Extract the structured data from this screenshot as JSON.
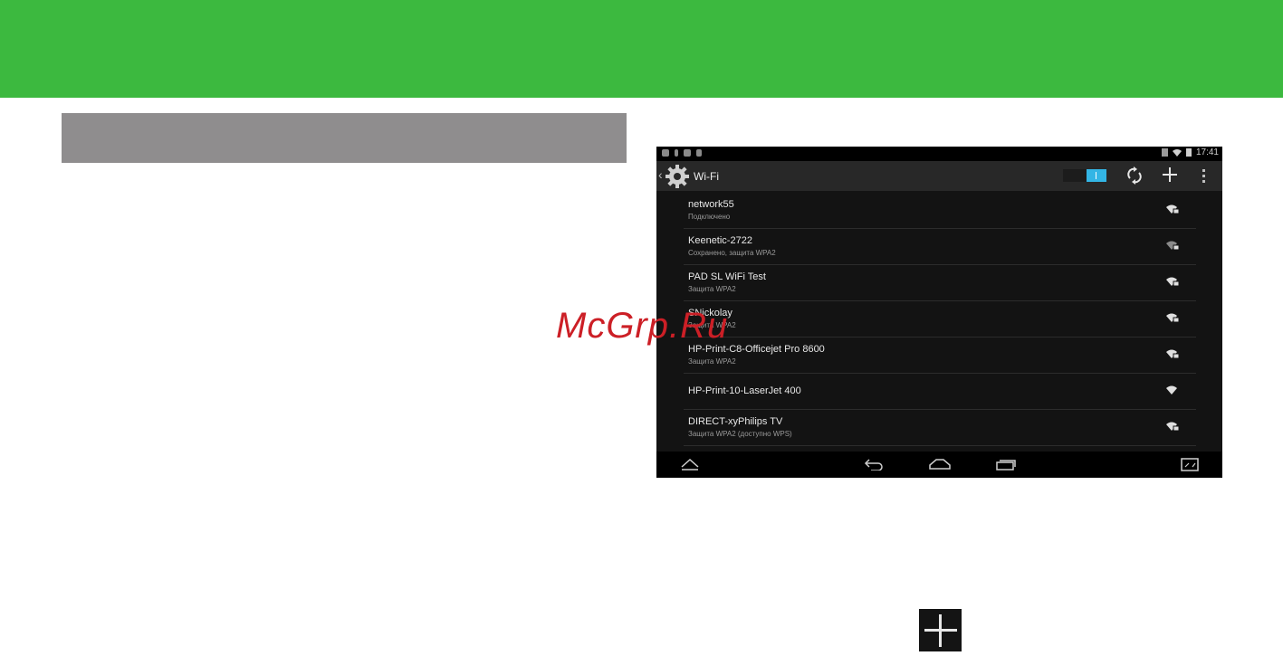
{
  "watermark": "McGrp.Ru",
  "status_bar": {
    "time": "17:41",
    "icons_left": [
      "cloud-icon",
      "usb-icon",
      "mail-icon",
      "sd-card-icon"
    ],
    "icons_right": [
      "mute-icon",
      "wifi-icon",
      "battery-icon"
    ]
  },
  "action_bar": {
    "back_glyph": "‹",
    "title": "Wi-Fi",
    "toggle_state": "on",
    "accent_color": "#33b5e5",
    "actions": [
      "refresh-icon",
      "add-network-icon",
      "overflow-menu-icon"
    ]
  },
  "networks": [
    {
      "name": "network55",
      "status": "Подключено",
      "secured": true
    },
    {
      "name": "Keenetic-2722",
      "status": "Сохранено, защита WPA2",
      "secured": true
    },
    {
      "name": "PAD SL WiFi Test",
      "status": "Защита WPA2",
      "secured": true
    },
    {
      "name": "SNickolay",
      "status": "Защита WPA2",
      "secured": true
    },
    {
      "name": "HP-Print-C8-Officejet Pro 8600",
      "status": "Защита WPA2",
      "secured": true
    },
    {
      "name": "HP-Print-10-LaserJet 400",
      "status": "",
      "secured": false
    },
    {
      "name": "DIRECT-xyPhilips TV",
      "status": "Защита WPA2 (доступно WPS)",
      "secured": true
    }
  ],
  "nav_bar": [
    "hide-keyboard-icon",
    "back-icon",
    "home-icon",
    "recent-apps-icon",
    "screenshot-icon"
  ],
  "colors": {
    "band": "#3cb93f",
    "grey_bar": "#8f8d8e",
    "watermark": "#cc1f26"
  }
}
